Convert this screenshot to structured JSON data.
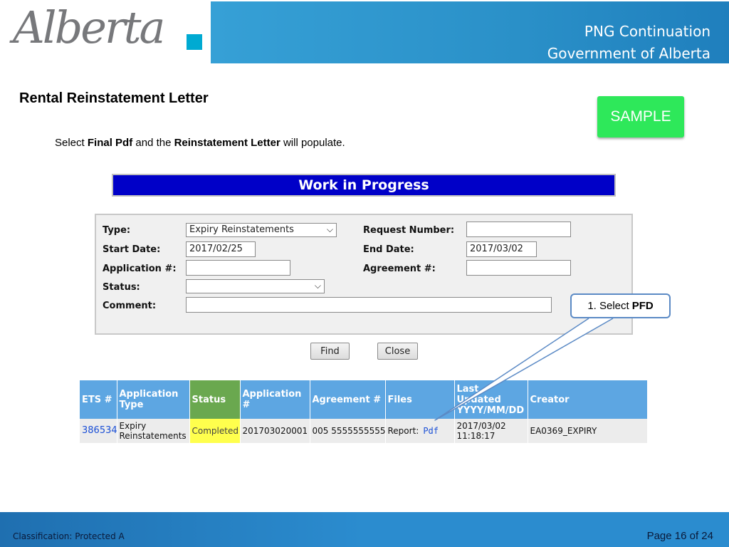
{
  "header": {
    "logo_text": "Alberta",
    "line1": "PNG Continuation",
    "line2": "Government of Alberta",
    "accent_color": "#00aad2"
  },
  "slide": {
    "title": "Rental Reinstatement Letter",
    "sample_label": "SAMPLE",
    "instruction_pre": "Select ",
    "instruction_b1": "Final Pdf",
    "instruction_mid": " and the ",
    "instruction_b2": "Reinstatement Letter",
    "instruction_post": " will populate."
  },
  "wip": {
    "title": "Work in Progress"
  },
  "form": {
    "type_label": "Type:",
    "type_value": "Expiry Reinstatements",
    "request_number_label": "Request Number:",
    "request_number_value": "",
    "start_date_label": "Start Date:",
    "start_date_value": "2017/02/25",
    "end_date_label": "End Date:",
    "end_date_value": "2017/03/02",
    "application_label": "Application #:",
    "application_value": "",
    "agreement_label": "Agreement #:",
    "agreement_value": "",
    "status_label": "Status:",
    "status_value": "",
    "comment_label": "Comment:",
    "comment_value": "",
    "find_label": "Find",
    "close_label": "Close"
  },
  "callout": {
    "prefix": "1. Select",
    "bold": "PFD"
  },
  "results": {
    "headers": {
      "ets": "ETS #",
      "app_type": "Application Type",
      "status": "Status",
      "application": "Application #",
      "agreement": "Agreement #",
      "files": "Files",
      "last_updated": "Last Updated YYYY/MM/DD",
      "creator": "Creator"
    },
    "row": {
      "ets": "386534",
      "app_type_1": "Expiry",
      "app_type_2": "Reinstatements",
      "status": "Completed",
      "application": "201703020001",
      "agreement": "005 5555555555",
      "files_label": "Report:",
      "files_link": "Pdf",
      "updated_date": "2017/03/02",
      "updated_time": "11:18:17",
      "creator": "EA0369_EXPIRY"
    }
  },
  "footer": {
    "classification": "Classification: Protected A",
    "page": "Page 16 of 24"
  }
}
